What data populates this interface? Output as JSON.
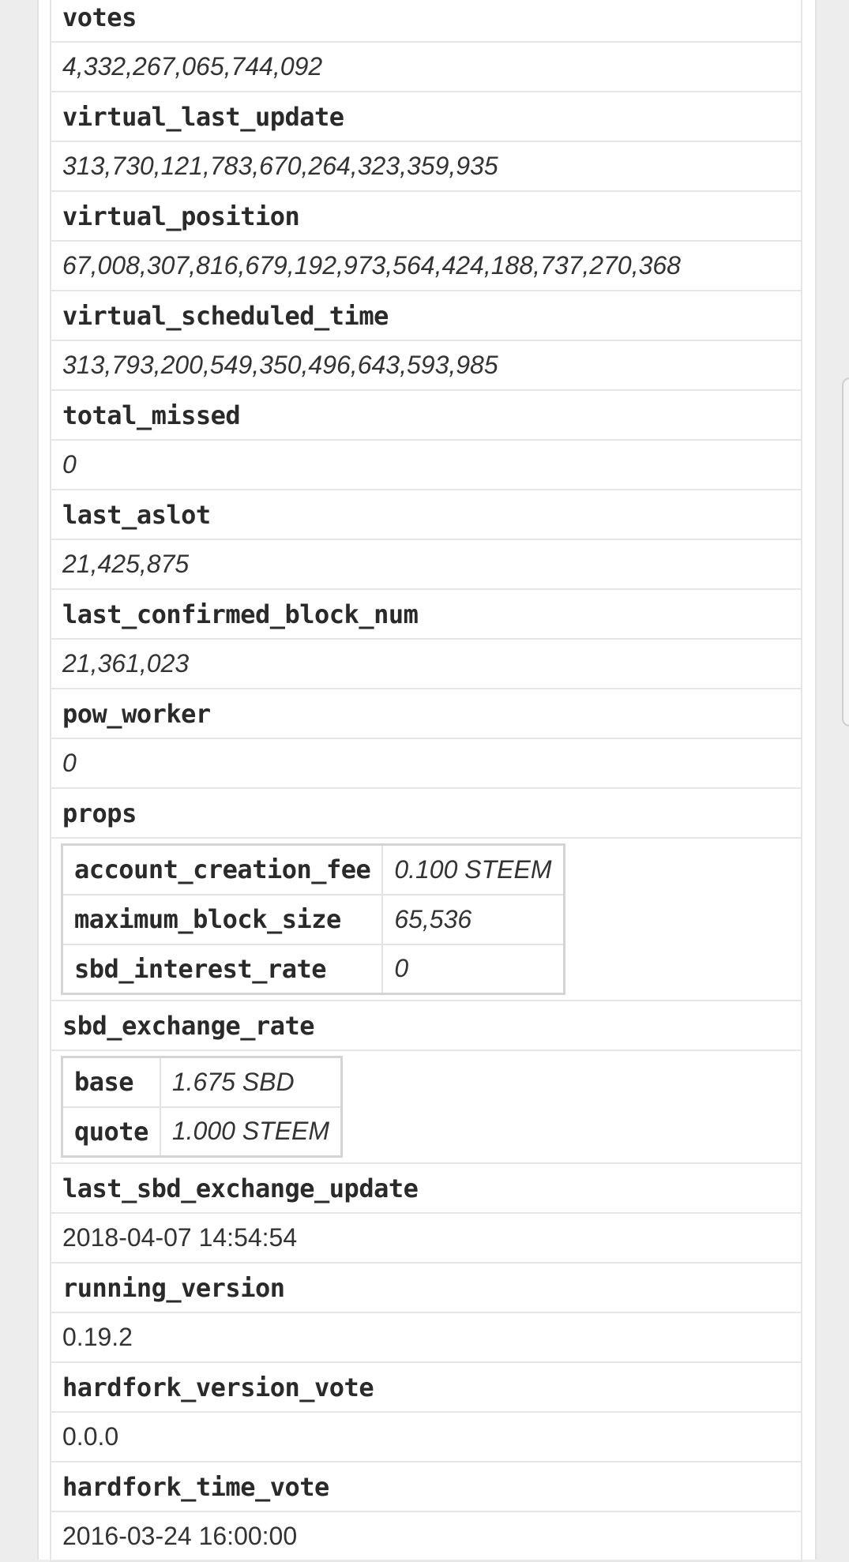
{
  "rows": [
    {
      "key": "votes",
      "value": "4,332,267,065,744,092"
    },
    {
      "key": "virtual_last_update",
      "value": "313,730,121,783,670,264,323,359,935"
    },
    {
      "key": "virtual_position",
      "value": "67,008,307,816,679,192,973,564,424,188,737,270,368"
    },
    {
      "key": "virtual_scheduled_time",
      "value": "313,793,200,549,350,496,643,593,985"
    },
    {
      "key": "total_missed",
      "value": "0"
    },
    {
      "key": "last_aslot",
      "value": "21,425,875"
    },
    {
      "key": "last_confirmed_block_num",
      "value": "21,361,023"
    },
    {
      "key": "pow_worker",
      "value": "0"
    }
  ],
  "props": {
    "key": "props",
    "entries": [
      {
        "key": "account_creation_fee",
        "value": "0.100 STEEM"
      },
      {
        "key": "maximum_block_size",
        "value": "65,536"
      },
      {
        "key": "sbd_interest_rate",
        "value": "0"
      }
    ]
  },
  "sbd_exchange_rate": {
    "key": "sbd_exchange_rate",
    "entries": [
      {
        "key": "base",
        "value": "1.675 SBD"
      },
      {
        "key": "quote",
        "value": "1.000 STEEM"
      }
    ]
  },
  "tail_rows": [
    {
      "key": "last_sbd_exchange_update",
      "value": "2018-04-07 14:54:54"
    },
    {
      "key": "running_version",
      "value": "0.19.2"
    },
    {
      "key": "hardfork_version_vote",
      "value": "0.0.0"
    },
    {
      "key": "hardfork_time_vote",
      "value": "2016-03-24 16:00:00"
    }
  ]
}
